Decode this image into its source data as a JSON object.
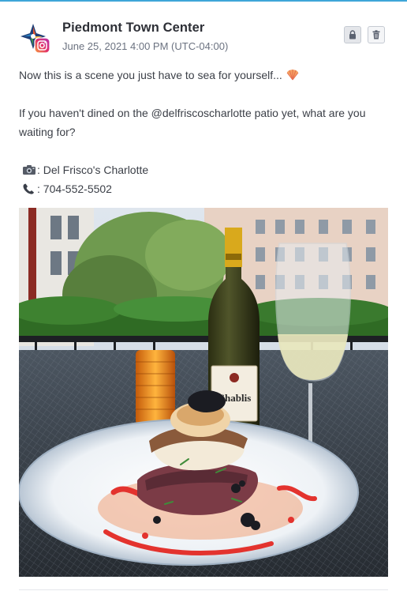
{
  "post": {
    "author": "Piedmont Town Center",
    "timestamp": "June 25, 2021 4:00 PM (UTC-04:00)",
    "network": "instagram",
    "caption_line1": "Now this is a scene you just have to sea for yourself...",
    "caption_line1_emoji": "shell-emoji",
    "caption_line2": "If you haven't dined on the @delfriscoscharlotte patio yet, what are you waiting for?",
    "camera_line": ": Del Frisco's Charlotte",
    "phone_line": ": 704-552-5502",
    "photo_wine_label": "Chablis"
  },
  "icons": {
    "lock": "lock-icon",
    "trash": "trash-icon",
    "camera": "camera-icon",
    "phone": "phone-icon",
    "instagram": "instagram-icon"
  },
  "colors": {
    "accent_line": "#3ea6d8",
    "instagram_gradient_start": "#f9a03f",
    "instagram_gradient_end": "#b32fb0"
  }
}
